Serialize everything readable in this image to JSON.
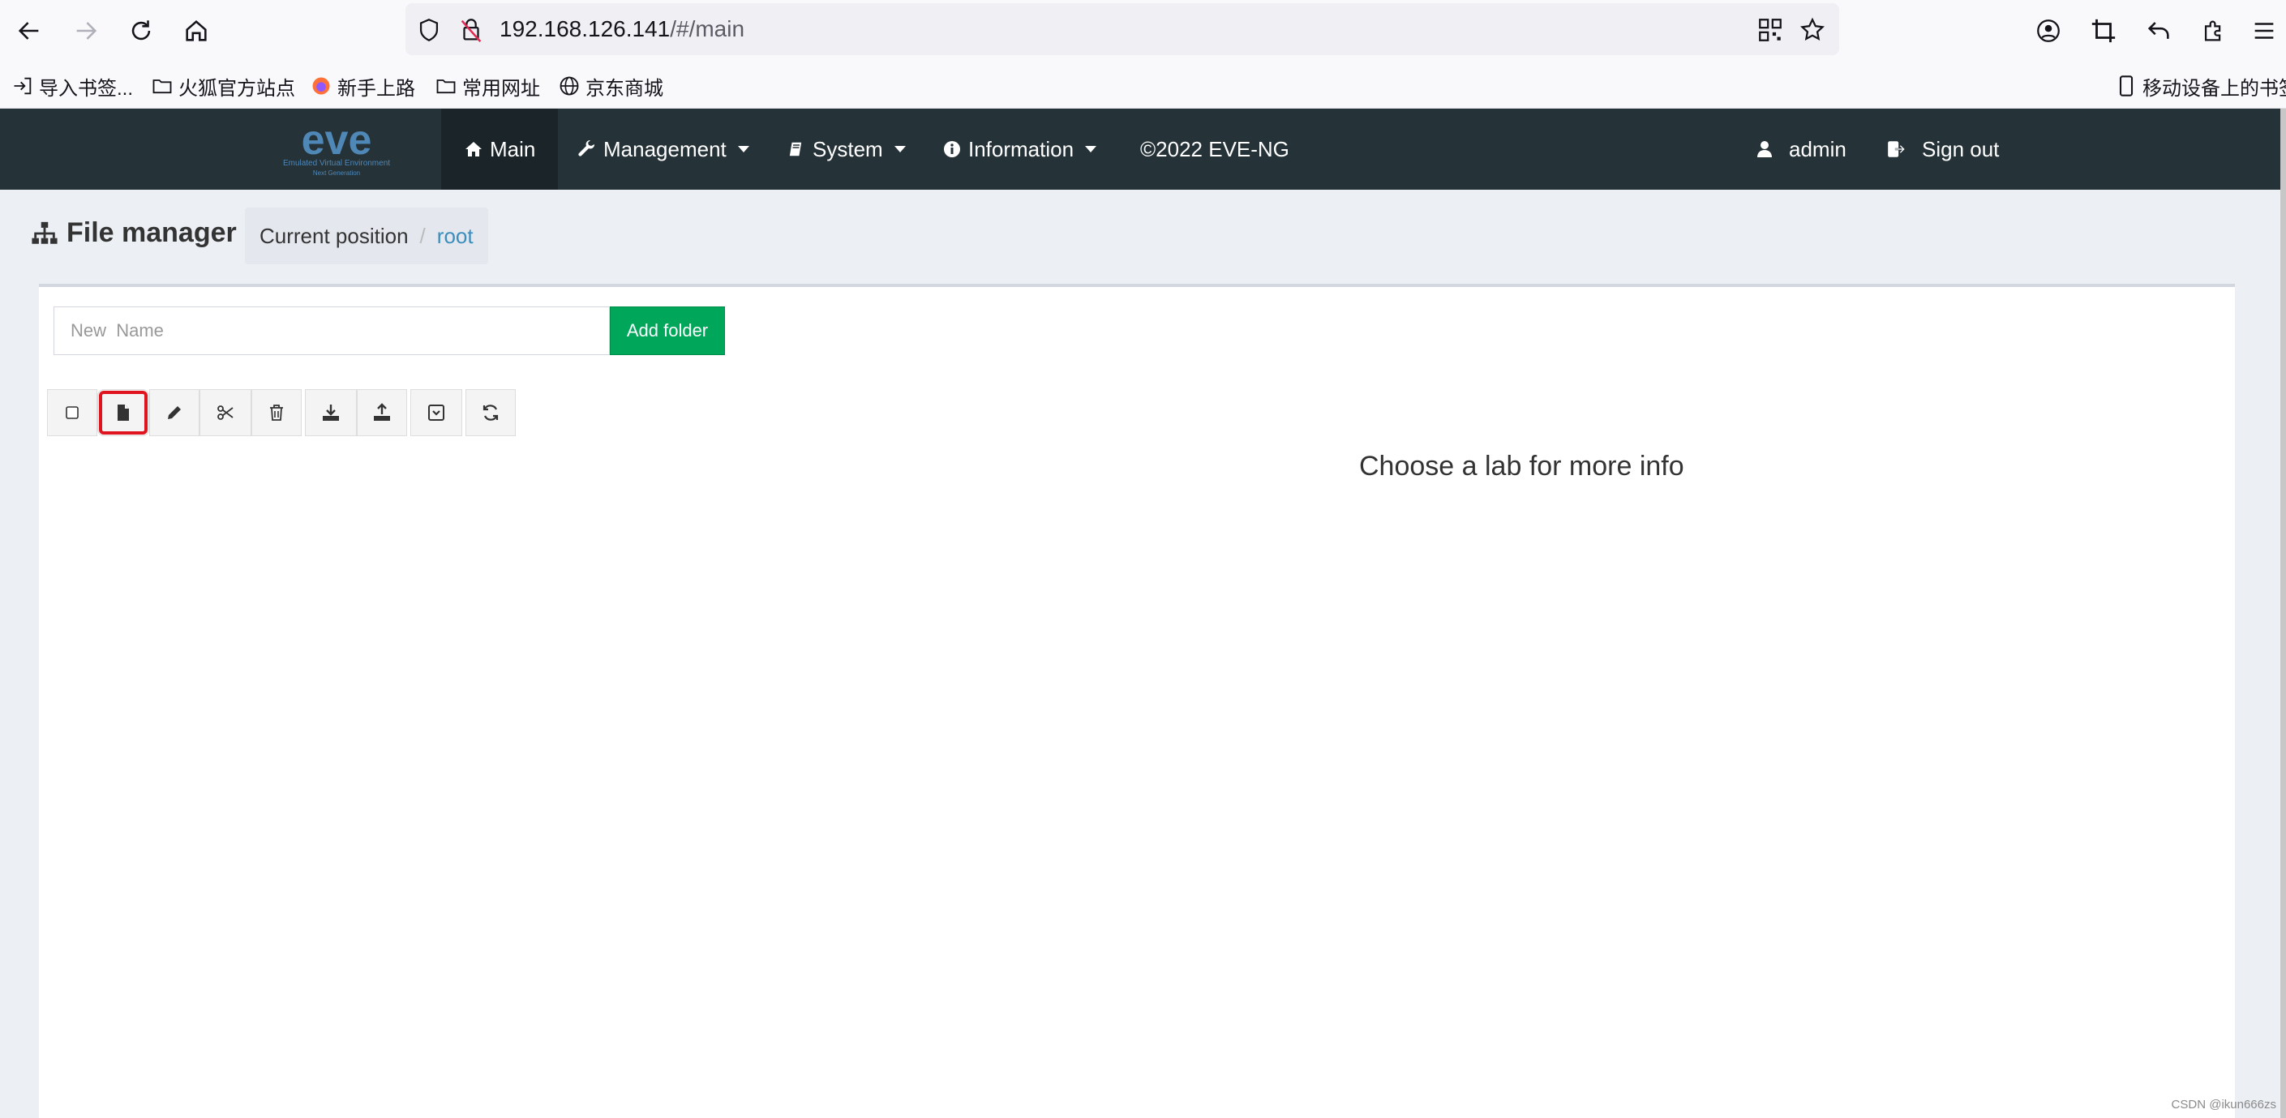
{
  "browser": {
    "url_host": "192.168.126.141",
    "url_path": "/#/main",
    "bookmarks": [
      {
        "label": "导入书签..."
      },
      {
        "label": "火狐官方站点"
      },
      {
        "label": "新手上路"
      },
      {
        "label": "常用网址"
      },
      {
        "label": "京东商城"
      }
    ],
    "mobile_bookmarks": "移动设备上的书签"
  },
  "navbar": {
    "logo_text": "eve",
    "logo_subtitle": "Emulated Virtual Environment",
    "logo_subtitle2": "Next Generation",
    "items": [
      {
        "label": "Main",
        "icon": "home-icon"
      },
      {
        "label": "Management",
        "icon": "wrench-icon"
      },
      {
        "label": "System",
        "icon": "book-icon"
      },
      {
        "label": "Information",
        "icon": "info-icon"
      }
    ],
    "copyright": "©2022 EVE-NG",
    "user": "admin",
    "signout": "Sign out"
  },
  "page": {
    "title": "File manager",
    "breadcrumb_current": "Current position",
    "breadcrumb_sep": "/",
    "breadcrumb_root": "root"
  },
  "filemanager": {
    "new_name_placeholder": "New  Name",
    "add_folder": "Add folder",
    "tools": [
      "select-all",
      "add-lab",
      "rename",
      "cut",
      "delete",
      "import",
      "export",
      "archive",
      "refresh"
    ],
    "info": "Choose a lab for more info"
  },
  "colors": {
    "navbar": "#253238",
    "add_folder": "#00a65a",
    "highlight": "#e0141e",
    "link": "#3c8dbc"
  },
  "watermark": "CSDN @ikun666zs"
}
